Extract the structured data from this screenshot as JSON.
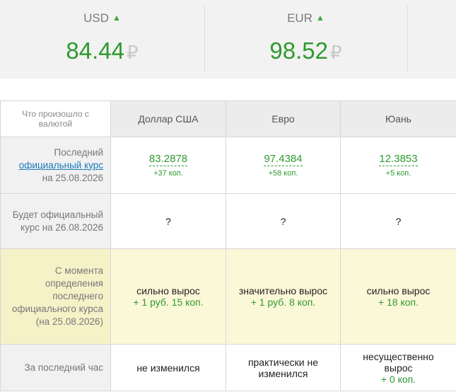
{
  "rates": [
    {
      "code": "USD",
      "arrow": "▲",
      "value": "84.44",
      "currency_sign": "₽"
    },
    {
      "code": "EUR",
      "arrow": "▲",
      "value": "98.52",
      "currency_sign": "₽"
    }
  ],
  "table": {
    "corner": "Что произошло с валютой",
    "columns": [
      "Доллар США",
      "Евро",
      "Юань"
    ],
    "row_official": {
      "label_line1": "Последний",
      "label_link": "официальный курс",
      "label_line3": "на 25.08.2026",
      "values": [
        {
          "rate": "83.2878",
          "diff": "+37 коп."
        },
        {
          "rate": "97.4384",
          "diff": "+58 коп."
        },
        {
          "rate": "12.3853",
          "diff": "+5 коп."
        }
      ]
    },
    "row_next": {
      "label": "Будет официальный курс на 26.08.2026",
      "values": [
        "?",
        "?",
        "?"
      ]
    },
    "row_since": {
      "label": "С момента определения последнего официального курса (на 25.08.2026)",
      "values": [
        {
          "text": "сильно вырос",
          "amount": "+ 1 руб. 15 коп."
        },
        {
          "text": "значительно вырос",
          "amount": "+ 1 руб. 8 коп."
        },
        {
          "text": "сильно вырос",
          "amount": "+ 18 коп."
        }
      ]
    },
    "row_hour": {
      "label": "За последний час",
      "values": [
        {
          "text": "не изменился",
          "amount": ""
        },
        {
          "text": "практически не изменился",
          "amount": ""
        },
        {
          "text": "несущественно вырос",
          "amount": "+ 0 коп."
        }
      ]
    }
  }
}
